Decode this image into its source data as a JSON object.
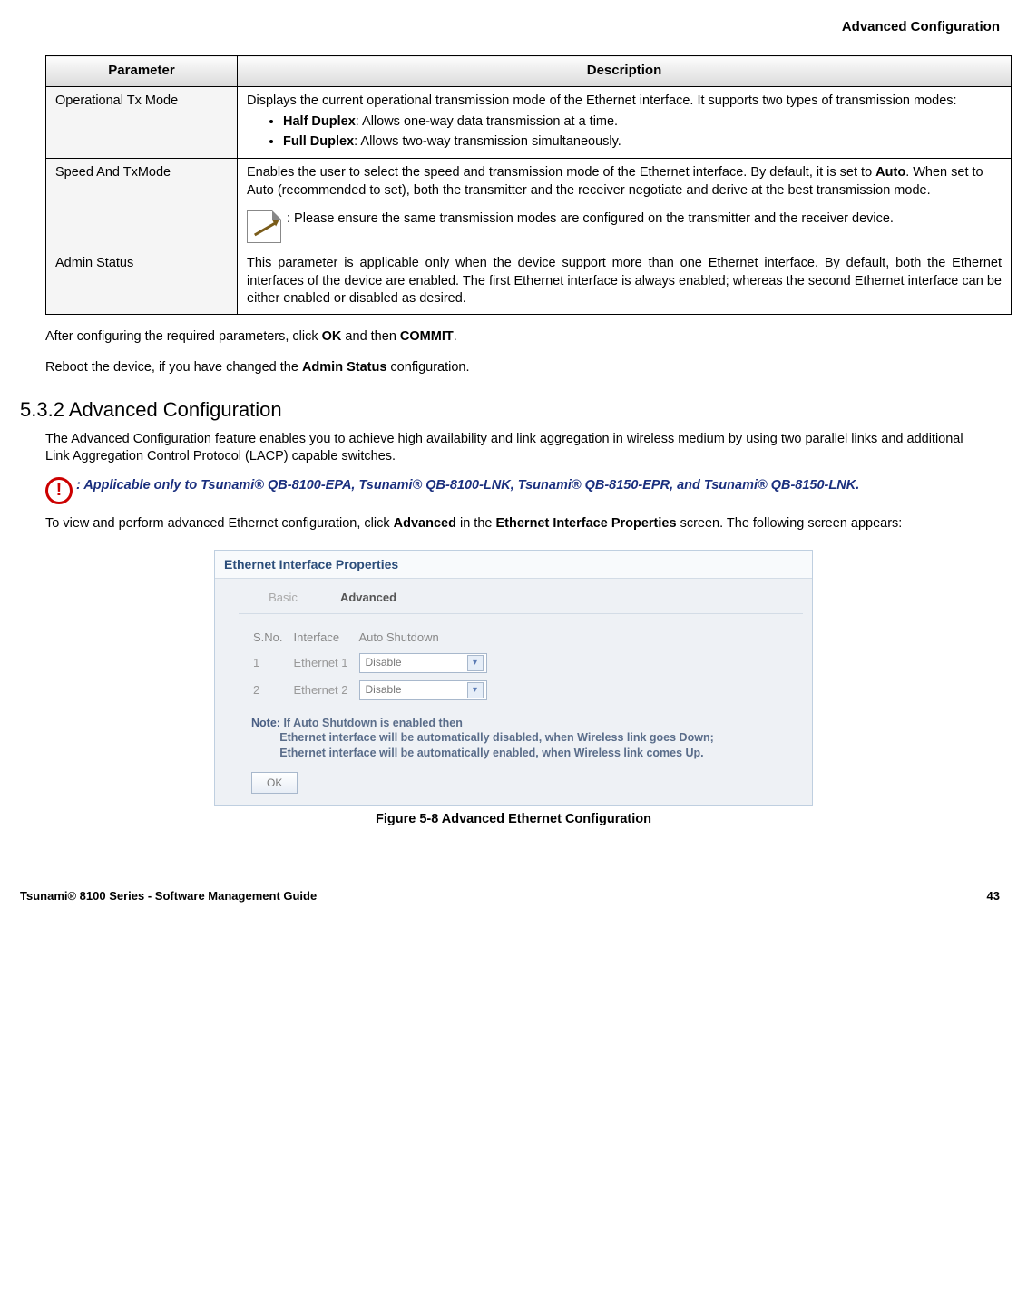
{
  "header_title": "Advanced Configuration",
  "table": {
    "headers": {
      "param": "Parameter",
      "desc": "Description"
    },
    "rows": [
      {
        "param": "Operational Tx Mode",
        "desc_intro": "Displays the current operational transmission mode of the Ethernet interface. It supports two types of transmission modes:",
        "bullets": [
          {
            "bold": "Half Duplex",
            "rest": ": Allows one-way data transmission at a time."
          },
          {
            "bold": "Full Duplex",
            "rest": ": Allows two-way transmission simultaneously."
          }
        ]
      },
      {
        "param": "Speed And TxMode",
        "desc_pre": "Enables the user to select the speed and transmission mode of the Ethernet interface. By default, it is set to ",
        "desc_bold": "Auto",
        "desc_post": ". When set to Auto (recommended to set), both the transmitter and the receiver negotiate and derive at the best transmission mode.",
        "note": ": Please ensure the same transmission modes are configured on the transmitter and the receiver device."
      },
      {
        "param": "Admin Status",
        "desc_full": "This parameter is applicable only when the device support more than one Ethernet interface. By default, both the Ethernet interfaces of the device are enabled. The first Ethernet interface is always enabled; whereas the second Ethernet interface can be either enabled or disabled as desired."
      }
    ]
  },
  "after_table": {
    "line1_pre": "After configuring the required parameters, click ",
    "line1_b1": "OK",
    "line1_mid": " and then ",
    "line1_b2": "COMMIT",
    "line1_post": ".",
    "line2_pre": "Reboot the device, if you have changed the ",
    "line2_b": "Admin Status",
    "line2_post": " configuration."
  },
  "section_heading": "5.3.2 Advanced Configuration",
  "section_intro": "The Advanced Configuration feature enables you to achieve high availability and link aggregation in wireless medium by using two parallel links and additional Link Aggregation Control Protocol (LACP) capable switches.",
  "warning": ": Applicable only to Tsunami® QB-8100-EPA, Tsunami® QB-8100-LNK, Tsunami® QB-8150-EPR, and Tsunami® QB-8150-LNK.",
  "nav_line": {
    "pre": "To view and perform advanced Ethernet configuration, click ",
    "b1": "Advanced",
    "mid": " in the ",
    "b2": "Ethernet Interface Properties",
    "post": " screen. The following screen appears:"
  },
  "screenshot": {
    "panel_title": "Ethernet Interface Properties",
    "tabs": {
      "basic": "Basic",
      "advanced": "Advanced"
    },
    "headers": {
      "sno": "S.No.",
      "iface": "Interface",
      "auto": "Auto Shutdown"
    },
    "rows": [
      {
        "sno": "1",
        "iface": "Ethernet 1",
        "sel": "Disable"
      },
      {
        "sno": "2",
        "iface": "Ethernet 2",
        "sel": "Disable"
      }
    ],
    "note_label": "Note:",
    "note_line1": "If Auto Shutdown is enabled then",
    "note_line2": "Ethernet interface will be automatically disabled, when Wireless link goes Down;",
    "note_line3": "Ethernet interface will be automatically enabled, when Wireless link comes Up.",
    "ok": "OK"
  },
  "figure_caption": "Figure 5-8 Advanced Ethernet Configuration",
  "footer": {
    "left": "Tsunami® 8100 Series - Software Management Guide",
    "right": "43"
  }
}
